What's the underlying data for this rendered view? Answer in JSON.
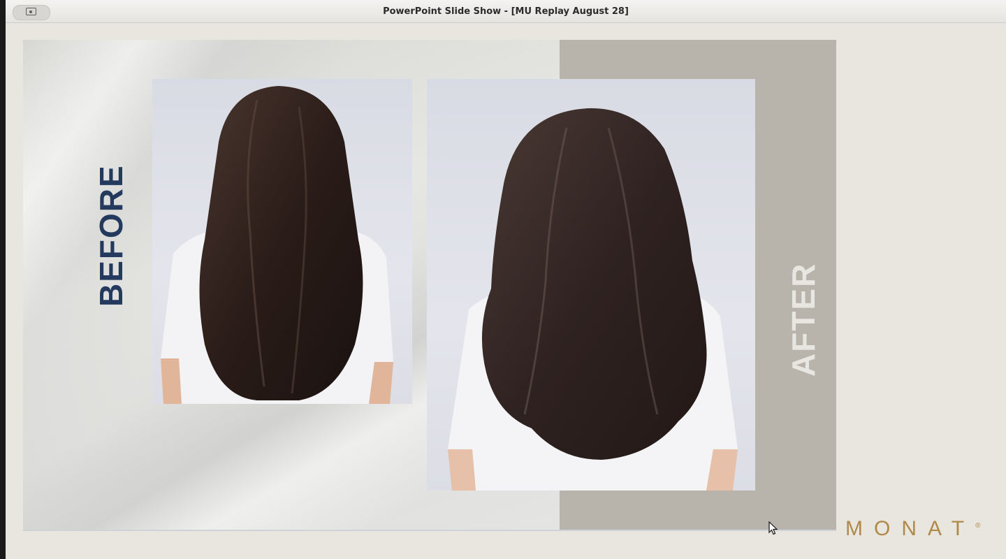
{
  "window": {
    "title": "PowerPoint Slide Show - [MU Replay August 28]"
  },
  "slide": {
    "before_label": "BEFORE",
    "after_label": "AFTER",
    "logo_text": "MONAT",
    "logo_mark": "®"
  },
  "images": {
    "before": "before-hair-photo",
    "after": "after-hair-photo"
  },
  "icons": {
    "screen_share": "screen-share-icon",
    "cursor": "mouse-cursor-icon"
  },
  "colors": {
    "before_text": "#233a5e",
    "after_panel": "#b8b4ab",
    "after_text": "#e8e6e1",
    "logo": "#b08a4a"
  }
}
